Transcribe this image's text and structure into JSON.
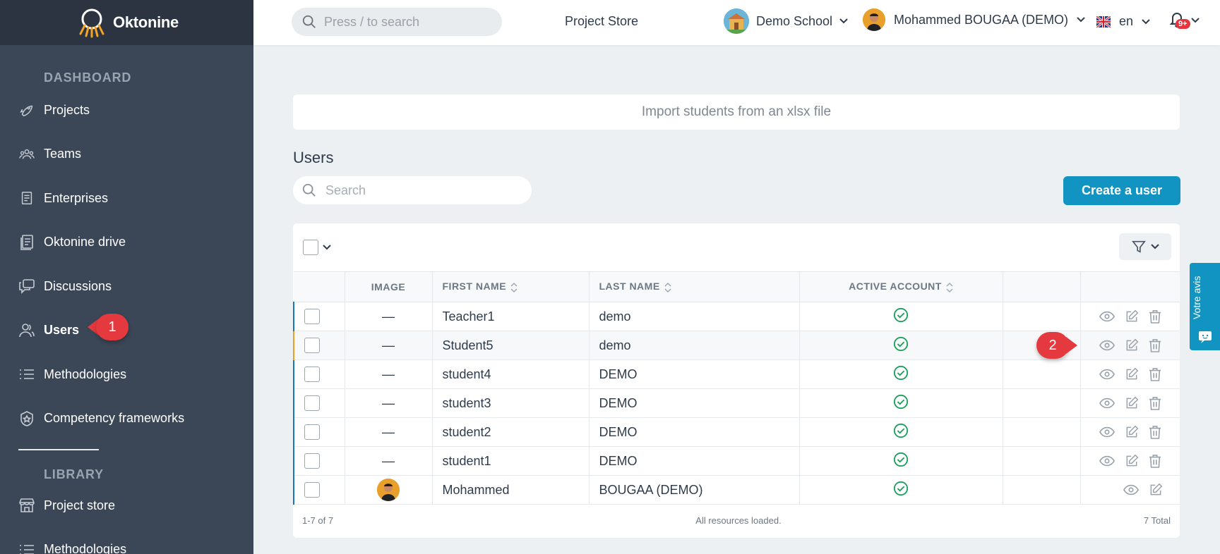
{
  "app": {
    "name": "Oktonine"
  },
  "header": {
    "search_placeholder": "Press / to search",
    "project_store": "Project Store",
    "school": "Demo School",
    "user": "Mohammed BOUGAA (DEMO)",
    "lang": "en",
    "notifications_badge": "9+"
  },
  "sidebar": {
    "dashboard_title": "DASHBOARD",
    "items": [
      {
        "label": "Projects",
        "icon": "rocket-icon"
      },
      {
        "label": "Teams",
        "icon": "team-icon"
      },
      {
        "label": "Enterprises",
        "icon": "enterprise-icon"
      },
      {
        "label": "Oktonine drive",
        "icon": "drive-icon"
      },
      {
        "label": "Discussions",
        "icon": "discussions-icon"
      },
      {
        "label": "Users",
        "icon": "users-icon",
        "active": true
      },
      {
        "label": "Methodologies",
        "icon": "list-icon"
      },
      {
        "label": "Competency frameworks",
        "icon": "badge-icon"
      }
    ],
    "library_title": "LIBRARY",
    "library_items": [
      {
        "label": "Project store",
        "icon": "store-icon"
      },
      {
        "label": "Methodologies",
        "icon": "list-icon"
      }
    ]
  },
  "main": {
    "import_label": "Import students from an xlsx file",
    "title": "Users",
    "search_placeholder": "Search",
    "create_button": "Create a user",
    "table": {
      "headers": [
        "IMAGE",
        "FIRST NAME",
        "LAST NAME",
        "ACTIVE ACCOUNT"
      ],
      "empty_image": "—",
      "rows": [
        {
          "first": "Teacher1",
          "last": "demo",
          "active": true
        },
        {
          "first": "Student5",
          "last": "demo",
          "active": true
        },
        {
          "first": "student4",
          "last": "DEMO",
          "active": true
        },
        {
          "first": "student3",
          "last": "DEMO",
          "active": true
        },
        {
          "first": "student2",
          "last": "DEMO",
          "active": true
        },
        {
          "first": "student1",
          "last": "DEMO",
          "active": true
        },
        {
          "first": "Mohammed",
          "last": "BOUGAA (DEMO)",
          "active": true
        }
      ],
      "footer_range": "1-7 of 7",
      "footer_status": "All resources loaded.",
      "footer_total": "7 Total"
    }
  },
  "callouts": {
    "one": "1",
    "two": "2"
  },
  "feedback_tab": "Votre avis",
  "colors": {
    "sidebar": "#3b4656",
    "accent": "#1194c1",
    "callout": "#e4393e",
    "success": "#1aa05a"
  }
}
